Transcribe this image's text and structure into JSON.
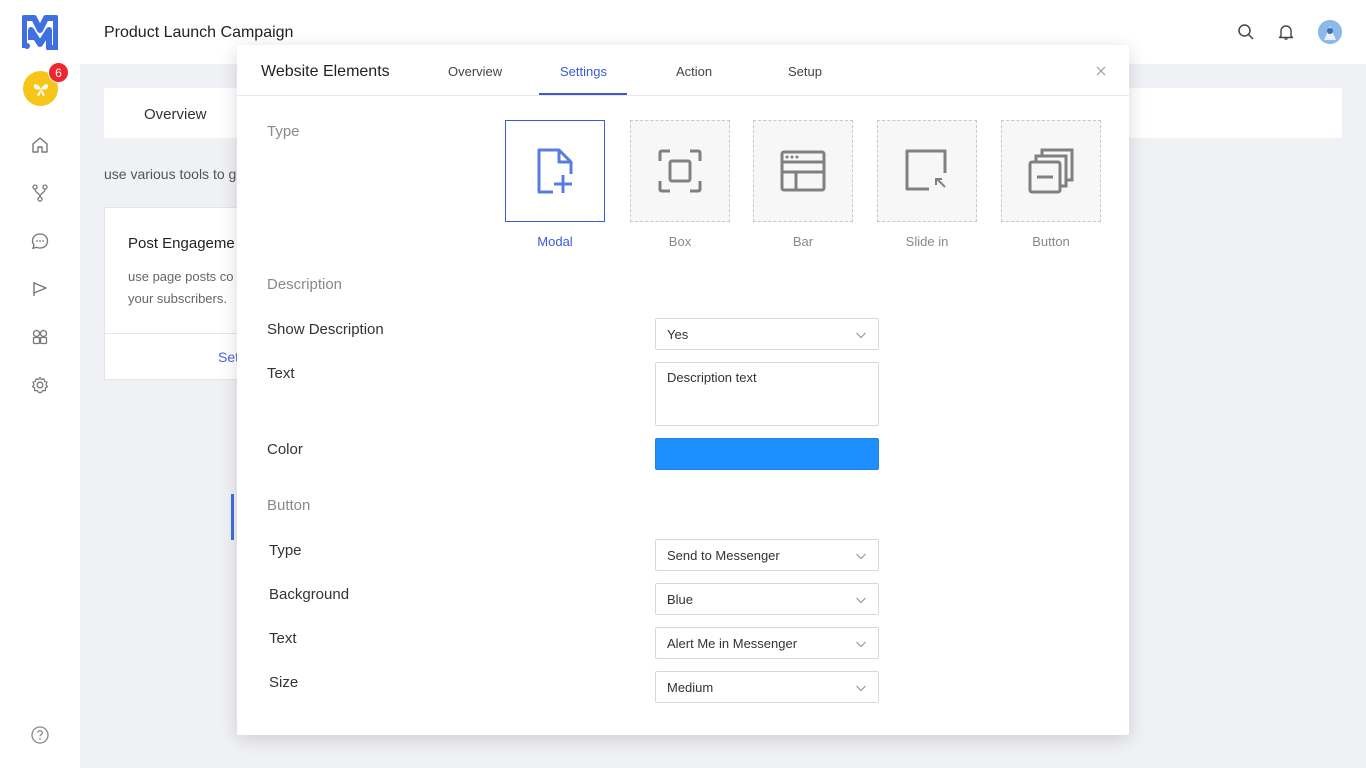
{
  "app": {
    "page_title": "Product Launch Campaign",
    "notification_count": "6"
  },
  "sidebar": {
    "items": [
      {
        "icon": "home-icon"
      },
      {
        "icon": "flow-icon"
      },
      {
        "icon": "chat-icon"
      },
      {
        "icon": "campaign-icon"
      },
      {
        "icon": "widgets-icon"
      },
      {
        "icon": "gear-icon"
      }
    ],
    "help_icon": "help-icon"
  },
  "background": {
    "tab_overview": "Overview",
    "hint_text": "use various tools to g",
    "card_title": "Post Engageme",
    "card_desc": "use page posts co your subscribers.",
    "card_setup": "Set"
  },
  "modal": {
    "title": "Website Elements",
    "tabs": [
      {
        "label": "Overview"
      },
      {
        "label": "Settings",
        "active": true
      },
      {
        "label": "Action"
      },
      {
        "label": "Setup"
      }
    ],
    "type_section_label": "Type",
    "types": [
      {
        "label": "Modal",
        "icon": "modal-icon",
        "selected": true
      },
      {
        "label": "Box",
        "icon": "box-icon"
      },
      {
        "label": "Bar",
        "icon": "bar-icon"
      },
      {
        "label": "Slide in",
        "icon": "slide-in-icon"
      },
      {
        "label": "Button",
        "icon": "button-icon"
      }
    ],
    "description_section": {
      "label": "Description",
      "show_description_label": "Show Description",
      "show_description_value": "Yes",
      "text_label": "Text",
      "text_value": "Description text",
      "color_label": "Color",
      "color_value": "#1e8fff"
    },
    "button_section": {
      "label": "Button",
      "type_label": "Type",
      "type_value": "Send to Messenger",
      "background_label": "Background",
      "background_value": "Blue",
      "text_label": "Text",
      "text_value": "Alert Me in Messenger",
      "size_label": "Size",
      "size_value": "Medium"
    }
  },
  "colors": {
    "accent": "#3b5bdb",
    "brand": "#3f6fe0",
    "badge": "#f0262e"
  }
}
